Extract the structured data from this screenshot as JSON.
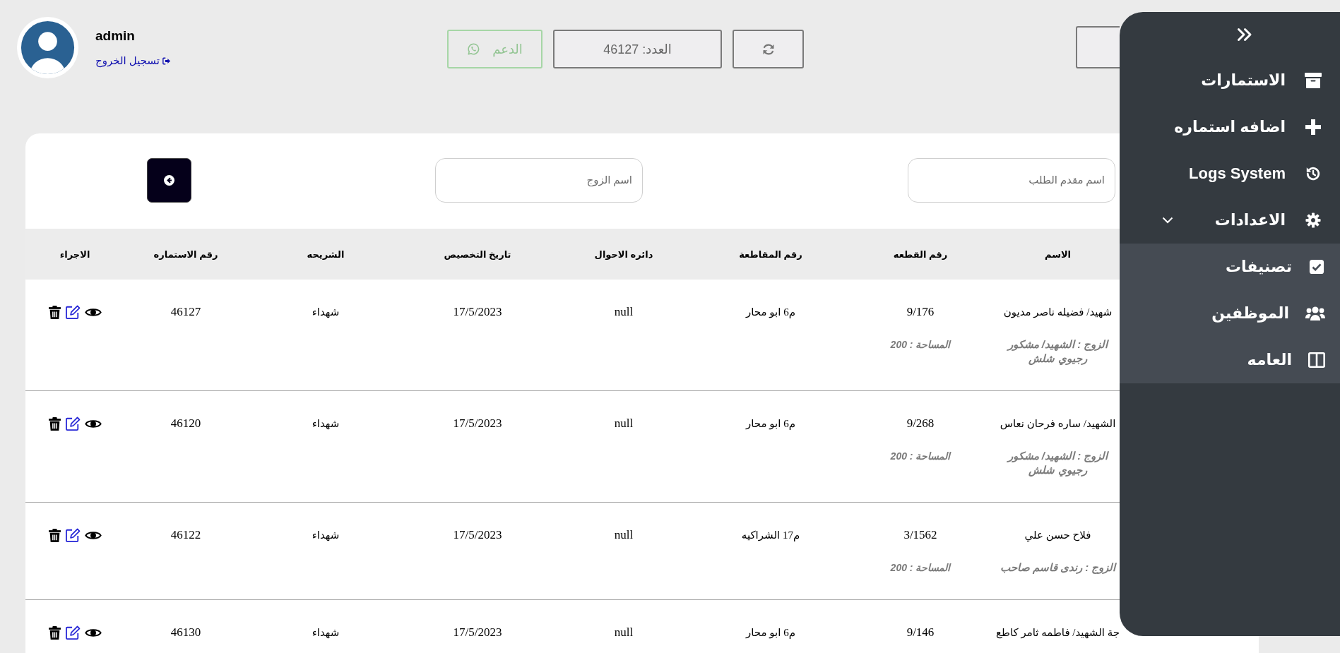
{
  "header": {
    "user": {
      "name": "admin",
      "logout": "تسجيل الخروج"
    },
    "support_button": "الدعم",
    "count": "العدد: 46127"
  },
  "sidebar": {
    "items": [
      {
        "label": "الاستمارات"
      },
      {
        "label": "اضافه استماره"
      },
      {
        "label": "Logs System"
      },
      {
        "label": "الاعدادات",
        "expanded": true,
        "children": [
          {
            "label": "تصنيفات"
          },
          {
            "label": "الموظفين"
          },
          {
            "label": "العامه"
          }
        ]
      }
    ]
  },
  "filters": [
    {
      "placeholder": "اسم مقدم الطلب"
    },
    {
      "placeholder": "اسم الزوج"
    }
  ],
  "table": {
    "columns": [
      "الاسم",
      "رقم القطعه",
      "رقم المقاطعة",
      "دائره الاحوال",
      "تاريخ التخصيص",
      "الشريحه",
      "رقم الاستماره",
      "الاجراء"
    ],
    "rows": [
      {
        "name": "شهيد/ فضيله ناصر مديون",
        "spouse": "الزوج : الشهيد/ مشكور رجيوي شلش",
        "plot": "9/176",
        "area": "المساحة : 200",
        "district": "م6 ابو محار",
        "registry": "null",
        "date": "17/5/2023",
        "category": "شهداء",
        "form_no": "46127"
      },
      {
        "name": "الشهيد/ ساره فرحان نعاس",
        "spouse": "الزوج : الشهيد/ مشكور رجيوي شلش",
        "plot": "9/268",
        "area": "المساحة : 200",
        "district": "م6 ابو محار",
        "registry": "null",
        "date": "17/5/2023",
        "category": "شهداء",
        "form_no": "46120"
      },
      {
        "name": "فلاح حسن علي",
        "spouse": "الزوج : رندى قاسم صاحب",
        "plot": "3/1562",
        "area": "المساحة : 200",
        "district": "م17 الشراكيه",
        "registry": "null",
        "date": "17/5/2023",
        "category": "شهداء",
        "form_no": "46122"
      },
      {
        "name": "جة الشهيد/ فاطمه ثامر كاطع",
        "plot": "9/146",
        "district": "م6 ابو محار",
        "registry": "null",
        "date": "17/5/2023",
        "category": "شهداء",
        "form_no": "46130"
      }
    ]
  }
}
